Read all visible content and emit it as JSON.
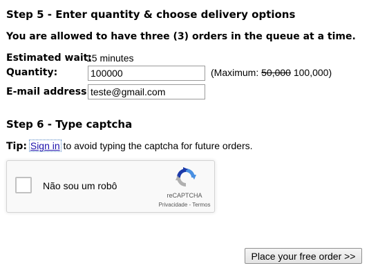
{
  "step5": {
    "title": "Step 5 - Enter quantity & choose delivery options",
    "notice": "You are allowed to have three (3) orders in the queue at a time.",
    "estimated_wait_label": "Estimated wait:",
    "estimated_wait_value": "15 minutes",
    "quantity_label": "Quantity:",
    "quantity_value": "100000",
    "max_prefix": "(Maximum: ",
    "max_old": "50,000",
    "max_new": " 100,000)",
    "email_label": "E-mail address:",
    "email_value": "teste@gmail.com"
  },
  "step6": {
    "title": "Step 6 - Type captcha",
    "tip_label": "Tip:",
    "tip_link": "Sign in",
    "tip_text": " to avoid typing the captcha for future orders."
  },
  "recaptcha": {
    "checkbox_label": "Não sou um robô",
    "brand": "reCAPTCHA",
    "privacy": "Privacidade",
    "separator": " - ",
    "terms": "Termos",
    "icon": "recaptcha-logo",
    "colors": {
      "blue": "#4a90e2",
      "dark_blue": "#1c3aa9",
      "gray": "#b0b0b0"
    }
  },
  "actions": {
    "submit_label": "Place your free order >>"
  }
}
